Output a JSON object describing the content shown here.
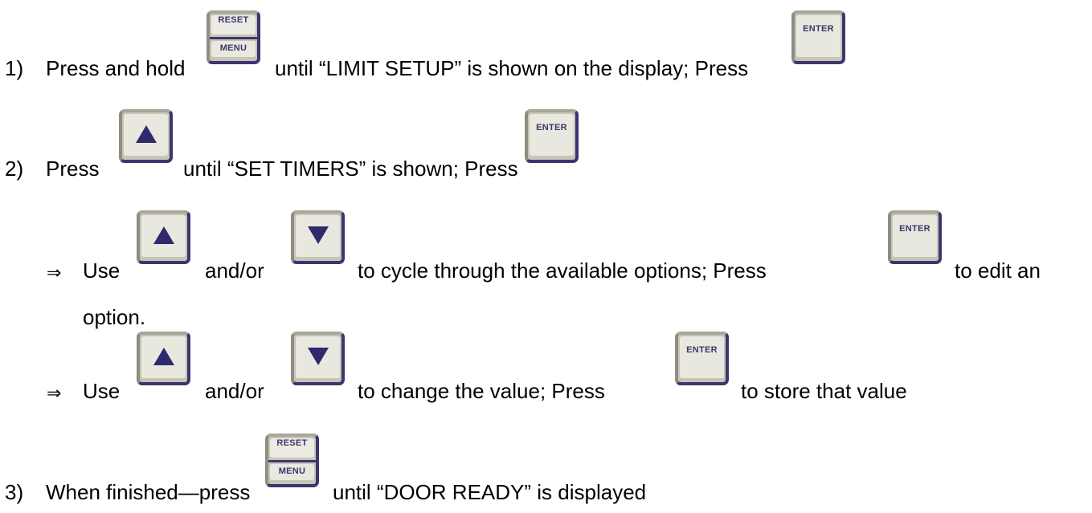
{
  "buttons": {
    "reset_top": "RESET",
    "reset_bottom": "MENU",
    "enter": "ENTER",
    "up_icon": "up-arrow-icon",
    "down_icon": "down-arrow-icon"
  },
  "colors": {
    "key_border": "#3d3570",
    "key_face": "#e9e8df",
    "arrow": "#2e2a6b"
  },
  "steps": {
    "step1": {
      "number": "1)",
      "text_a": "Press and hold",
      "text_b": "until “LIMIT SETUP” is shown on the display; Press"
    },
    "step2": {
      "number": "2)",
      "text_a": "Press",
      "text_b": "until “SET TIMERS” is shown; Press"
    },
    "sub1": {
      "bullet": "⇒",
      "text_a": "Use",
      "text_b": "and/or",
      "text_c": "to cycle through the available options;  Press",
      "text_d": "to edit an",
      "text_e": "option."
    },
    "sub2": {
      "bullet": "⇒",
      "text_a": "Use",
      "text_b": "and/or",
      "text_c": "to change the value;  Press",
      "text_d": "to store that value"
    },
    "step3": {
      "number": "3)",
      "text_a": "When finished—press",
      "text_b": "until “DOOR READY” is displayed"
    }
  }
}
